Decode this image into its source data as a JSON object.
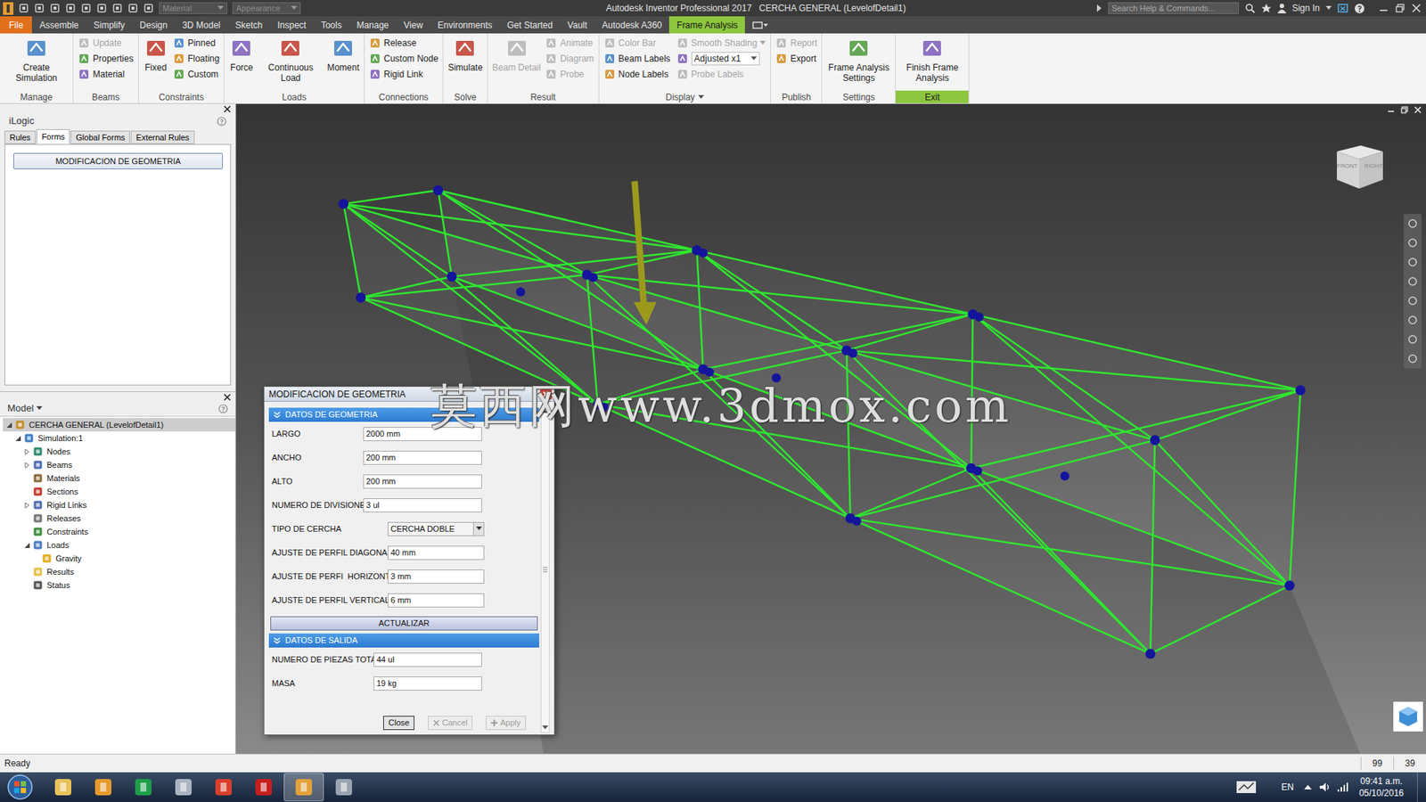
{
  "titlebar": {
    "title": "Autodesk Inventor Professional 2017   CERCHA GENERAL (LevelofDetail1)",
    "quick_fields": [
      "Material",
      "Appearance"
    ],
    "search_placeholder": "Search Help & Commands...",
    "sign_in": "Sign In"
  },
  "menu_tabs": [
    {
      "label": "File",
      "kind": "app",
      "selected": false
    },
    {
      "label": "Assemble",
      "kind": "tab",
      "selected": false
    },
    {
      "label": "Simplify",
      "kind": "tab",
      "selected": false
    },
    {
      "label": "Design",
      "kind": "tab",
      "selected": false
    },
    {
      "label": "3D Model",
      "kind": "tab",
      "selected": false
    },
    {
      "label": "Sketch",
      "kind": "tab",
      "selected": false
    },
    {
      "label": "Inspect",
      "kind": "tab",
      "selected": false
    },
    {
      "label": "Tools",
      "kind": "tab",
      "selected": false
    },
    {
      "label": "Manage",
      "kind": "tab",
      "selected": false
    },
    {
      "label": "View",
      "kind": "tab",
      "selected": false
    },
    {
      "label": "Environments",
      "kind": "tab",
      "selected": false
    },
    {
      "label": "Get Started",
      "kind": "tab",
      "selected": false
    },
    {
      "label": "Vault",
      "kind": "tab",
      "selected": false
    },
    {
      "label": "Autodesk A360",
      "kind": "tab",
      "selected": false
    },
    {
      "label": "Frame Analysis",
      "kind": "tab",
      "selected": true
    }
  ],
  "ribbon": {
    "groups": [
      {
        "label": "Manage",
        "menu": false,
        "highlight": false,
        "tools": [
          {
            "label": "Create Simulation",
            "kind": "large",
            "disabled": false
          }
        ]
      },
      {
        "label": "Beams",
        "menu": false,
        "highlight": false,
        "tools": [
          {
            "label": "Update",
            "kind": "small",
            "disabled": true
          },
          {
            "label": "Properties",
            "kind": "small",
            "disabled": false
          },
          {
            "label": "Material",
            "kind": "small",
            "disabled": false
          }
        ]
      },
      {
        "label": "Constraints",
        "menu": false,
        "highlight": false,
        "tools": [
          {
            "label": "Fixed",
            "kind": "large",
            "disabled": false
          },
          {
            "label": "Pinned",
            "kind": "small",
            "disabled": false
          },
          {
            "label": "Floating",
            "kind": "small",
            "disabled": false
          },
          {
            "label": "Custom",
            "kind": "small",
            "disabled": false
          }
        ]
      },
      {
        "label": "Loads",
        "menu": false,
        "highlight": false,
        "tools": [
          {
            "label": "Force",
            "kind": "large",
            "disabled": false
          },
          {
            "label": "Continuous Load",
            "kind": "large",
            "disabled": false
          },
          {
            "label": "Moment",
            "kind": "large",
            "disabled": false
          }
        ]
      },
      {
        "label": "Connections",
        "menu": false,
        "highlight": false,
        "tools": [
          {
            "label": "Release",
            "kind": "small",
            "disabled": false
          },
          {
            "label": "Custom Node",
            "kind": "small",
            "disabled": false
          },
          {
            "label": "Rigid Link",
            "kind": "small",
            "disabled": false
          }
        ]
      },
      {
        "label": "Solve",
        "menu": false,
        "highlight": false,
        "tools": [
          {
            "label": "Simulate",
            "kind": "large",
            "disabled": false
          }
        ]
      },
      {
        "label": "Result",
        "menu": false,
        "highlight": false,
        "tools": [
          {
            "label": "Beam Detail",
            "kind": "large",
            "disabled": true
          },
          {
            "label": "Animate",
            "kind": "small",
            "disabled": true
          },
          {
            "label": "Diagram",
            "kind": "small",
            "disabled": true
          },
          {
            "label": "Probe",
            "kind": "small",
            "disabled": true
          }
        ]
      },
      {
        "label": "Display",
        "menu": true,
        "highlight": false,
        "tools": [
          {
            "label": "Color Bar",
            "kind": "small",
            "disabled": true
          },
          {
            "label": "Beam Labels",
            "kind": "small",
            "disabled": false
          },
          {
            "label": "Node Labels",
            "kind": "small",
            "disabled": false
          },
          {
            "label": "Smooth Shading",
            "kind": "split",
            "disabled": true
          },
          {
            "label": "Adjusted x1",
            "kind": "dropdown",
            "disabled": false
          },
          {
            "label": "Probe Labels",
            "kind": "small",
            "disabled": true
          }
        ]
      },
      {
        "label": "Publish",
        "menu": false,
        "highlight": false,
        "tools": [
          {
            "label": "Report",
            "kind": "small",
            "disabled": true
          },
          {
            "label": "Export",
            "kind": "small",
            "disabled": false
          }
        ]
      },
      {
        "label": "Settings",
        "menu": false,
        "highlight": false,
        "tools": [
          {
            "label": "Frame Analysis Settings",
            "kind": "large",
            "disabled": false
          }
        ]
      },
      {
        "label": "Exit",
        "menu": false,
        "highlight": true,
        "tools": [
          {
            "label": "Finish Frame Analysis",
            "kind": "large",
            "disabled": false
          }
        ]
      }
    ]
  },
  "ilogic": {
    "title": "iLogic",
    "tabs": [
      {
        "label": "Rules",
        "selected": false
      },
      {
        "label": "Forms",
        "selected": true
      },
      {
        "label": "Global Forms",
        "selected": false
      },
      {
        "label": "External Rules",
        "selected": false
      }
    ],
    "button": "MODIFICACION DE GEOMETRIA"
  },
  "model": {
    "title": "Model",
    "tree": [
      {
        "label": "CERCHA GENERAL (LevelofDetail1)",
        "level": 0,
        "has_children": true,
        "expanded": true,
        "selected": true
      },
      {
        "label": "Simulation:1",
        "level": 1,
        "has_children": true,
        "expanded": true,
        "selected": false
      },
      {
        "label": "Nodes",
        "level": 2,
        "has_children": true,
        "expanded": false,
        "selected": false
      },
      {
        "label": "Beams",
        "level": 2,
        "has_children": true,
        "expanded": false,
        "selected": false
      },
      {
        "label": "Materials",
        "level": 2,
        "has_children": false,
        "expanded": false,
        "selected": false
      },
      {
        "label": "Sections",
        "level": 2,
        "has_children": false,
        "expanded": false,
        "selected": false
      },
      {
        "label": "Rigid Links",
        "level": 2,
        "has_children": true,
        "expanded": false,
        "selected": false
      },
      {
        "label": "Releases",
        "level": 2,
        "has_children": false,
        "expanded": false,
        "selected": false
      },
      {
        "label": "Constraints",
        "level": 2,
        "has_children": false,
        "expanded": false,
        "selected": false
      },
      {
        "label": "Loads",
        "level": 2,
        "has_children": true,
        "expanded": true,
        "selected": false
      },
      {
        "label": "Gravity",
        "level": 3,
        "has_children": false,
        "expanded": false,
        "selected": false
      },
      {
        "label": "Results",
        "level": 2,
        "has_children": false,
        "expanded": false,
        "selected": false
      },
      {
        "label": "Status",
        "level": 2,
        "has_children": false,
        "expanded": false,
        "selected": false
      }
    ]
  },
  "viewcube": [
    "FRONT",
    "RIGHT"
  ],
  "watermark": "莫西网www.3dmox.com",
  "dialog": {
    "title": "MODIFICACION DE GEOMETRIA",
    "sections": [
      {
        "title": "DATOS DE GEOMETRIA",
        "expanded": true,
        "fields": [
          {
            "label": "LARGO",
            "value": "2000 mm",
            "kind": "input"
          },
          {
            "label": "ANCHO",
            "value": "200 mm",
            "kind": "input"
          },
          {
            "label": "ALTO",
            "value": "200 mm",
            "kind": "input"
          },
          {
            "label": "NUMERO DE DIVISIONES",
            "value": "3 ul",
            "kind": "input"
          },
          {
            "label": "TIPO DE CERCHA",
            "value": "CERCHA DOBLE",
            "kind": "select"
          },
          {
            "label": "AJUSTE DE PERFIL DIAGONAL",
            "value": "40 mm",
            "kind": "adjust"
          },
          {
            "label": "AJUSTE DE PERFI  HORIZONTAL",
            "value": "3 mm",
            "kind": "adjust"
          },
          {
            "label": "AJUSTE DE PERFIL VERTICAL",
            "value": "6 mm",
            "kind": "adjust"
          }
        ],
        "button": "ACTUALIZAR"
      },
      {
        "title": "DATOS DE SALIDA",
        "expanded": true,
        "fields": [
          {
            "label": "NUMERO DE PIEZAS TOTAL",
            "value": "44 ul",
            "kind": "output"
          },
          {
            "label": "MASA",
            "value": "19 kg",
            "kind": "output"
          }
        ],
        "button": ""
      }
    ],
    "buttons": [
      {
        "label": "Close",
        "disabled": false
      },
      {
        "label": "Cancel",
        "disabled": true
      },
      {
        "label": "Apply",
        "disabled": true
      }
    ]
  },
  "status_bar": {
    "left": "Ready",
    "right": [
      "99",
      "39"
    ]
  },
  "taskbar": {
    "lang": "EN",
    "time": "09:41 a.m.",
    "date": "05/10/2016"
  }
}
